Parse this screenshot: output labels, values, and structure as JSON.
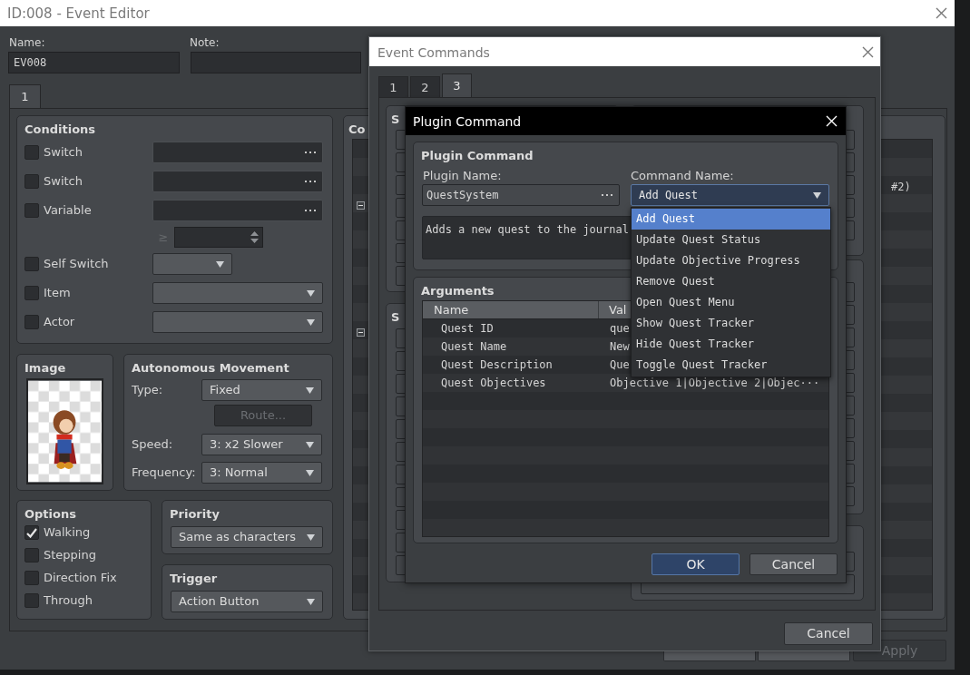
{
  "event_editor": {
    "title": "ID:008 - Event Editor",
    "name_label": "Name:",
    "name_value": "EV008",
    "note_label": "Note:",
    "page_tabs": [
      {
        "label": "1",
        "selected": true
      }
    ],
    "conditions": {
      "title": "Conditions",
      "rows": [
        {
          "kind": "picker",
          "label": "Switch",
          "checked": false
        },
        {
          "kind": "picker",
          "label": "Switch",
          "checked": false
        },
        {
          "kind": "variable",
          "label": "Variable",
          "checked": false,
          "operator": "≥"
        },
        {
          "kind": "short_select",
          "label": "Self Switch",
          "checked": false
        },
        {
          "kind": "select",
          "label": "Item",
          "checked": false
        },
        {
          "kind": "select",
          "label": "Actor",
          "checked": false
        }
      ]
    },
    "image": {
      "title": "Image"
    },
    "movement": {
      "title": "Autonomous Movement",
      "fields": [
        {
          "label": "Type:",
          "value": "Fixed"
        },
        {
          "label": "Speed:",
          "value": "3: x2 Slower"
        },
        {
          "label": "Frequency:",
          "value": "3: Normal"
        }
      ],
      "route_button": {
        "label": "Route...",
        "disabled": true
      }
    },
    "options": {
      "title": "Options",
      "items": [
        {
          "label": "Walking",
          "checked": true
        },
        {
          "label": "Stepping",
          "checked": false
        },
        {
          "label": "Direction Fix",
          "checked": false
        },
        {
          "label": "Through",
          "checked": false
        }
      ]
    },
    "priority": {
      "title": "Priority",
      "value": "Same as characters"
    },
    "trigger": {
      "title": "Trigger",
      "value": "Action Button"
    },
    "contents": {
      "title": "Co",
      "line_fragment": "#2)"
    },
    "apply_button": {
      "label": "Apply",
      "disabled": true
    }
  },
  "event_commands": {
    "title": "Event Commands",
    "tabs": [
      {
        "label": "1",
        "selected": false
      },
      {
        "label": "2",
        "selected": false
      },
      {
        "label": "3",
        "selected": true
      }
    ],
    "group_titles": [
      "S",
      "S"
    ],
    "cancel_button": "Cancel"
  },
  "plugin_command": {
    "title": "Plugin Command",
    "group_title": "Plugin Command",
    "plugin_name_label": "Plugin Name:",
    "plugin_name": "QuestSystem",
    "command_name_label": "Command Name:",
    "command_name": "Add Quest",
    "description": "Adds a new quest to the journal",
    "arguments_title": "Arguments",
    "columns": [
      "Name",
      "Val"
    ],
    "rows": [
      {
        "name": "Quest ID",
        "value": "que"
      },
      {
        "name": "Quest Name",
        "value": "New"
      },
      {
        "name": "Quest Description",
        "value": "Que"
      },
      {
        "name": "Quest Objectives",
        "value": "Objective 1|Objective 2|Objec···"
      }
    ],
    "buttons": [
      {
        "label": "OK",
        "kind": "primary"
      },
      {
        "label": "Cancel",
        "kind": "normal"
      }
    ]
  },
  "command_dropdown": {
    "items": [
      {
        "label": "Add Quest",
        "selected": true
      },
      {
        "label": "Update Quest Status",
        "selected": false
      },
      {
        "label": "Update Objective Progress",
        "selected": false
      },
      {
        "label": "Remove Quest",
        "selected": false
      },
      {
        "label": "Open Quest Menu",
        "selected": false
      },
      {
        "label": "Show Quest Tracker",
        "selected": false
      },
      {
        "label": "Hide Quest Tracker",
        "selected": false
      },
      {
        "label": "Toggle Quest Tracker",
        "selected": false
      }
    ]
  }
}
